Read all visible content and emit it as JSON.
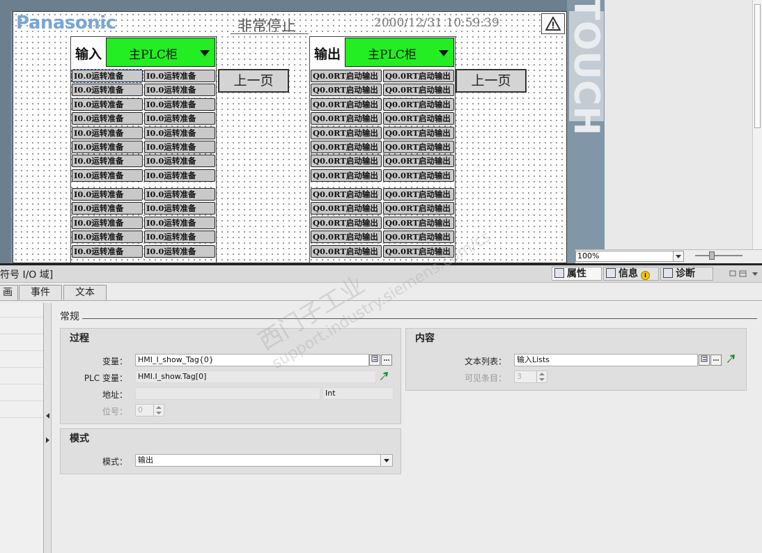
{
  "hmi": {
    "brand": "Panasonic",
    "status_title": "非常停止",
    "datetime": "2000/12/31 10:59:39",
    "side_text": "TOUCH",
    "input_panel": {
      "label": "输入",
      "combo_value": "主PLC柜",
      "cell_text": "I0.0运转准备",
      "page_button": "上一页"
    },
    "output_panel": {
      "label": "输出",
      "combo_value": "主PLC柜",
      "cell_text": "Q0.0RT启动输出",
      "page_button": "上一页"
    }
  },
  "zoom": {
    "value": "100%"
  },
  "inspector": {
    "title": "符号 I/O 域]",
    "right_tabs": [
      "属性",
      "信息",
      "诊断"
    ],
    "info_badge": "i",
    "subtabs": [
      "画",
      "事件",
      "文本"
    ],
    "section": "常规",
    "process": {
      "title": "过程",
      "tag_label": "变量：",
      "tag_value": "HMI_I_show_Tag{0}",
      "plc_tag_label": "PLC 变量：",
      "plc_tag_value": "HMI.I_show.Tag[0]",
      "address_label": "地址：",
      "address_value": "",
      "address_type": "Int",
      "bit_label": "位号：",
      "bit_value": "0"
    },
    "mode": {
      "title": "模式",
      "label": "模式：",
      "value": "输出"
    },
    "content": {
      "title": "内容",
      "textlist_label": "文本列表：",
      "textlist_value": "输入Lists",
      "visible_label": "可见条目：",
      "visible_value": "3"
    }
  },
  "watermark": {
    "line1": "西门子工业",
    "line2": "support.industry.siemens.com/cs"
  }
}
